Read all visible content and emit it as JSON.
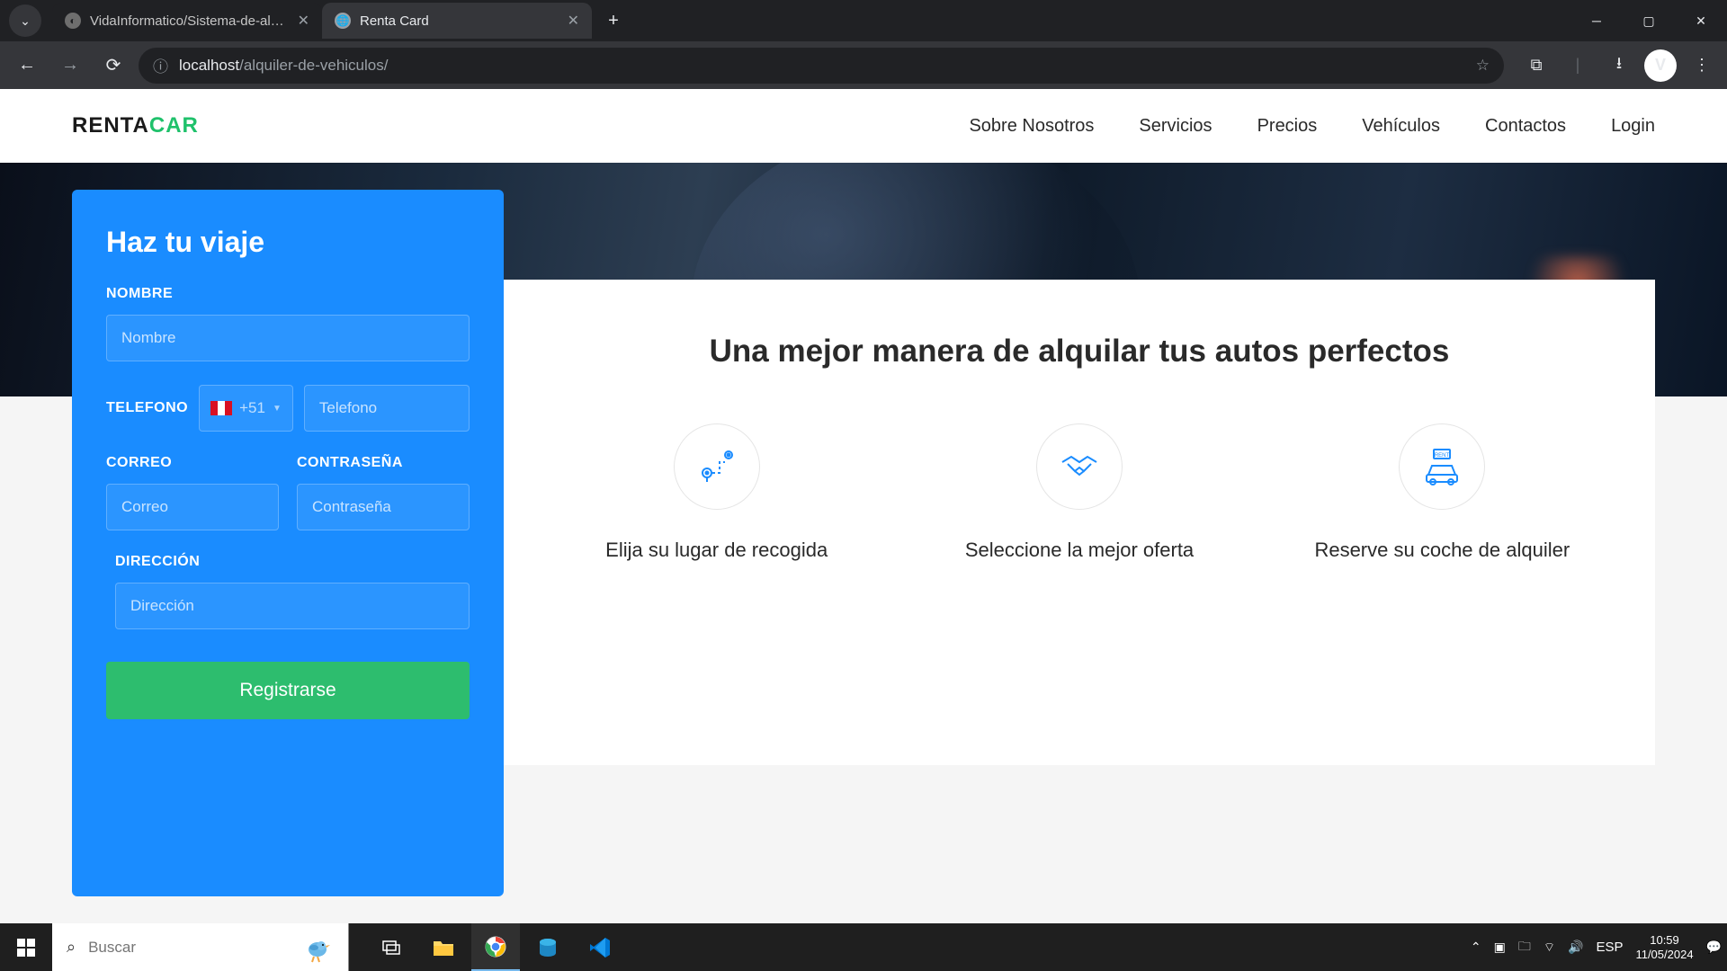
{
  "browser": {
    "tabs": [
      {
        "title": "VidaInformatico/Sistema-de-al…",
        "active": false
      },
      {
        "title": "Renta Card",
        "active": true
      }
    ],
    "address": {
      "scheme_label": "ⓘ",
      "host": "localhost",
      "path": "/alquiler-de-vehiculos/"
    }
  },
  "site": {
    "logo": {
      "part1": "RENTA",
      "part2": "CAR"
    },
    "nav": [
      "Sobre Nosotros",
      "Servicios",
      "Precios",
      "Vehículos",
      "Contactos",
      "Login"
    ]
  },
  "form": {
    "title": "Haz tu viaje",
    "name": {
      "label": "NOMBRE",
      "placeholder": "Nombre"
    },
    "phone": {
      "label": "TELEFONO",
      "dial": "+51",
      "placeholder": "Telefono"
    },
    "email": {
      "label": "CORREO",
      "placeholder": "Correo"
    },
    "password": {
      "label": "CONTRASEÑA",
      "placeholder": "Contraseña"
    },
    "address": {
      "label": "DIRECCIÓN",
      "placeholder": "Dirección"
    },
    "submit": "Registrarse"
  },
  "info": {
    "heading": "Una mejor manera de alquilar tus autos perfectos",
    "features": [
      "Elija su lugar de recogida",
      "Seleccione la mejor oferta",
      "Reserve su coche de alquiler"
    ]
  },
  "taskbar": {
    "search_placeholder": "Buscar",
    "lang": "ESP",
    "time": "10:59",
    "date": "11/05/2024"
  }
}
